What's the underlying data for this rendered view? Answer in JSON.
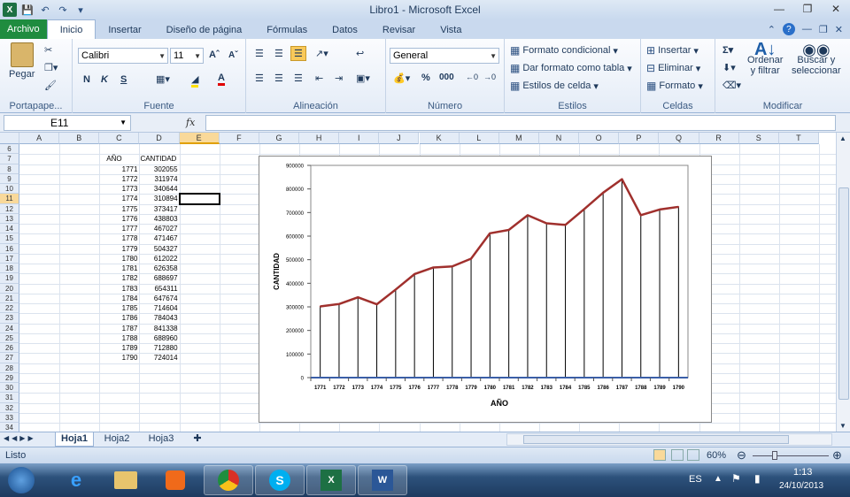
{
  "window": {
    "title": "Libro1 - Microsoft Excel"
  },
  "tabs": [
    "Archivo",
    "Inicio",
    "Insertar",
    "Diseño de página",
    "Fórmulas",
    "Datos",
    "Revisar",
    "Vista"
  ],
  "ribbon": {
    "clipboard": {
      "paste": "Pegar",
      "label": "Portapape..."
    },
    "font": {
      "name": "Calibri",
      "size": "11",
      "bold": "N",
      "italic": "K",
      "underline": "S",
      "label": "Fuente"
    },
    "alignment": {
      "label": "Alineación"
    },
    "number": {
      "format": "General",
      "percent": "%",
      "thousands": "000",
      "label": "Número"
    },
    "styles": {
      "conditional": "Formato condicional",
      "table": "Dar formato como tabla",
      "cell": "Estilos de celda",
      "label": "Estilos"
    },
    "cells": {
      "insert": "Insertar",
      "delete": "Eliminar",
      "format": "Formato",
      "label": "Celdas"
    },
    "edit": {
      "sort1": "Ordenar",
      "sort2": "y filtrar",
      "find1": "Buscar y",
      "find2": "seleccionar",
      "label": "Modificar"
    }
  },
  "formula": {
    "namebox": "E11",
    "fx": "fx"
  },
  "grid": {
    "columns": [
      "A",
      "B",
      "C",
      "D",
      "E",
      "F",
      "G",
      "H",
      "I",
      "J",
      "K",
      "L",
      "M",
      "N",
      "O",
      "P",
      "Q",
      "R",
      "S",
      "T"
    ],
    "rows": [
      "6",
      "7",
      "8",
      "9",
      "10",
      "11",
      "12",
      "13",
      "14",
      "15",
      "16",
      "17",
      "18",
      "19",
      "20",
      "21",
      "22",
      "23",
      "24",
      "25",
      "26",
      "27",
      "28",
      "29",
      "30",
      "31",
      "32",
      "33",
      "34"
    ],
    "header_year": "AÑO",
    "header_qty": "CANTIDAD",
    "years": [
      "1771",
      "1772",
      "1773",
      "1774",
      "1775",
      "1776",
      "1777",
      "1778",
      "1779",
      "1780",
      "1781",
      "1782",
      "1783",
      "1784",
      "1785",
      "1786",
      "1787",
      "1788",
      "1789",
      "1790"
    ],
    "quantities": [
      "302055",
      "311974",
      "340644",
      "310894",
      "373417",
      "438803",
      "467027",
      "471467",
      "504327",
      "612022",
      "626358",
      "688697",
      "654311",
      "647674",
      "714604",
      "784043",
      "841338",
      "688960",
      "712880",
      "724014"
    ]
  },
  "sheets": [
    "Hoja1",
    "Hoja2",
    "Hoja3"
  ],
  "status": {
    "ready": "Listo",
    "zoom": "60%"
  },
  "taskbar": {
    "lang": "ES",
    "time": "1:13",
    "date": "24/10/2013"
  },
  "chart_data": {
    "type": "line",
    "categories": [
      "1771",
      "1772",
      "1773",
      "1774",
      "1775",
      "1776",
      "1777",
      "1778",
      "1779",
      "1780",
      "1781",
      "1782",
      "1783",
      "1784",
      "1785",
      "1786",
      "1787",
      "1788",
      "1789",
      "1790"
    ],
    "values": [
      302055,
      311974,
      340644,
      310894,
      373417,
      438803,
      467027,
      471467,
      504327,
      612022,
      626358,
      688697,
      654311,
      647674,
      714604,
      784043,
      841338,
      688960,
      712880,
      724014
    ],
    "xlabel": "AÑO",
    "ylabel": "CANTIDAD",
    "ylim": [
      0,
      900000
    ],
    "yticks": [
      "0",
      "100000",
      "200000",
      "300000",
      "400000",
      "500000",
      "600000",
      "700000",
      "800000",
      "900000"
    ],
    "drop_lines": true,
    "colors": {
      "line": "#a0302d",
      "baseline": "#3a5fa8",
      "drop": "#000000"
    }
  }
}
